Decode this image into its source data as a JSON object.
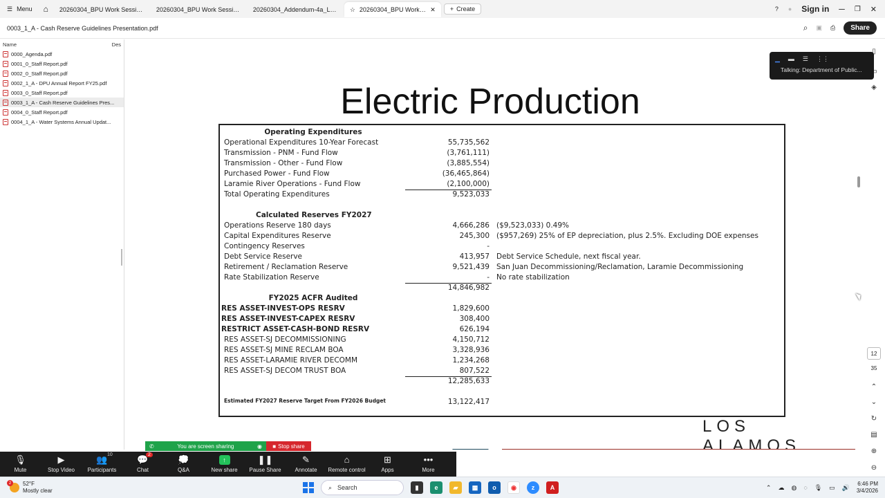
{
  "browser": {
    "menu_label": "Menu",
    "tabs": [
      {
        "label": "20260304_BPU Work Session A..."
      },
      {
        "label": "20260304_BPU Work Session P..."
      },
      {
        "label": "20260304_Addendum-4a_LAN..."
      },
      {
        "label": "20260304_BPU Work S..."
      }
    ],
    "create_label": "Create",
    "signin_label": "Sign in"
  },
  "doc": {
    "filename": "0003_1_A - Cash Reserve Guidelines Presentation.pdf",
    "share_label": "Share"
  },
  "sidebar": {
    "col_name": "Name",
    "col_desc": "Des",
    "files": [
      "0000_Agenda.pdf",
      "0001_0_Staff Report.pdf",
      "0002_0_Staff Report.pdf",
      "0002_1_A - DPU Annual Report FY25.pdf",
      "0003_0_Staff Report.pdf",
      "0003_1_A - Cash Reserve Guidelines Pres...",
      "0004_0_Staff Report.pdf",
      "0004_1_A - Water Systems Annual Updat..."
    ],
    "selected_index": 5
  },
  "slide": {
    "title": "Electric Production",
    "section_opex": "Operating Expenditures",
    "opex_rows": [
      {
        "label": "Operational Expenditures 10-Year Forecast",
        "value": "55,735,562"
      },
      {
        "label": "Transmission - PNM - Fund Flow",
        "value": "(3,761,111)"
      },
      {
        "label": "Transmission - Other - Fund Flow",
        "value": "(3,885,554)"
      },
      {
        "label": "Purchased Power - Fund Flow",
        "value": "(36,465,864)"
      },
      {
        "label": "Laramie River Operations - Fund Flow",
        "value": "(2,100,000)"
      },
      {
        "label": "Total Operating Expenditures",
        "value": "9,523,033"
      }
    ],
    "section_reserves": "Calculated Reserves FY2027",
    "reserve_rows": [
      {
        "label": "Operations Reserve 180 days",
        "value": "4,666,286",
        "note": "($9,523,033) 0.49%"
      },
      {
        "label": "Capital Expenditures Reserve",
        "value": "245,300",
        "note": "($957,269) 25% of EP depreciation, plus 2.5%. Excluding DOE expenses"
      },
      {
        "label": "Contingency Reserves",
        "value": "-",
        "note": ""
      },
      {
        "label": "Debt Service Reserve",
        "value": "413,957",
        "note": "Debt Service Schedule, next fiscal year."
      },
      {
        "label": "Retirement / Reclamation Reserve",
        "value": "9,521,439",
        "note": "San Juan Decommissioning/Reclamation, Laramie Decommissioning"
      },
      {
        "label": "Rate Stabilization Reserve",
        "value": "-",
        "note": "No rate stabilization"
      }
    ],
    "reserves_total": "14,846,982",
    "section_acfr": "FY2025 ACFR Audited",
    "acfr_rows": [
      {
        "label": "RES ASSET-INVEST-OPS RESRV",
        "value": "1,829,600"
      },
      {
        "label": "RES ASSET-INVEST-CAPEX RESRV",
        "value": "308,400"
      },
      {
        "label": "RESTRICT ASSET-CASH-BOND RESRV",
        "value": "626,194"
      },
      {
        "label": "RES ASSET-SJ DECOMMISSIONING",
        "value": "4,150,712"
      },
      {
        "label": "RES ASSET-SJ MINE RECLAM BOA",
        "value": "3,328,936"
      },
      {
        "label": "RES ASSET-LARAMIE RIVER DECOMM",
        "value": "1,234,268"
      },
      {
        "label": "RES ASSET-SJ DECOM TRUST BOA",
        "value": "807,522"
      }
    ],
    "acfr_total": "12,285,633",
    "estimate_label": "Estimated FY2027 Reserve Target From FY2026 Budget",
    "estimate_value": "13,122,417",
    "logo_text": "LOS ALAMOS"
  },
  "viewer": {
    "page_current": "12",
    "page_total": "35"
  },
  "zoom_mini": {
    "talking": "Talking: Department of Public..."
  },
  "zoom_share": {
    "sharing_text": "You are screen sharing",
    "stop_share_label": "Stop share"
  },
  "zoom_toolbar": {
    "mute": "Mute",
    "stop_video": "Stop Video",
    "participants": "Participants",
    "participants_count": "10",
    "chat": "Chat",
    "chat_badge": "2",
    "qa": "Q&A",
    "new_share": "New share",
    "pause_share": "Pause Share",
    "annotate": "Annotate",
    "remote_control": "Remote control",
    "apps": "Apps",
    "more": "More"
  },
  "taskbar": {
    "weather_temp": "52°F",
    "weather_desc": "Mostly clear",
    "weather_badge": "2",
    "search_placeholder": "Search",
    "time": "6:46 PM",
    "date": "3/4/2026"
  },
  "colors": {
    "zoom_green": "#1fa34a",
    "zoom_red": "#d6272d",
    "band_blue": "#1e4a5e",
    "band_red": "#9a2d25"
  }
}
